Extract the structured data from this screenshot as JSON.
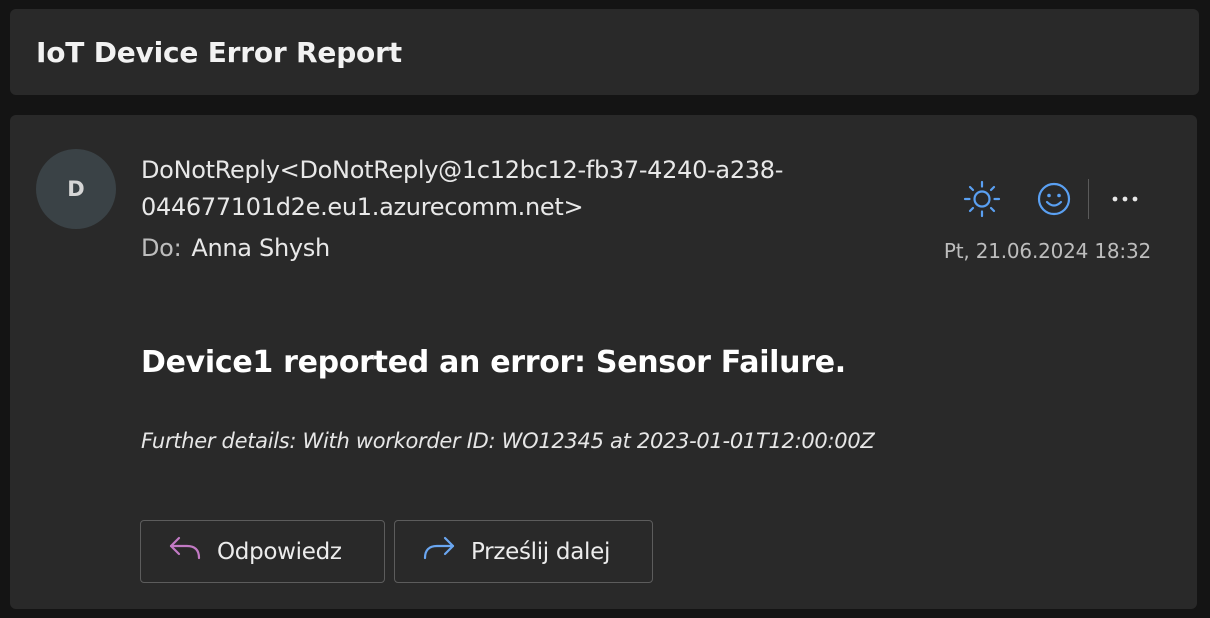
{
  "subject": "IoT Device Error Report",
  "message": {
    "avatar_initial": "D",
    "sender": "DoNotReply<DoNotReply@1c12bc12-fb37-4240-a238-044677101d2e.eu1.azurecomm.net>",
    "to_label": "Do:",
    "to_name": "Anna Shysh",
    "date": "Pt, 21.06.2024 18:32",
    "toolbar_icons": [
      "sun-icon",
      "emoji-icon",
      "more-icon"
    ],
    "body_title": "Device1 reported an error: Sensor Failure.",
    "body_details": "Further details: With workorder ID: WO12345 at 2023-01-01T12:00:00Z"
  },
  "actions": {
    "reply_label": "Odpowiedz",
    "forward_label": "Prześlij dalej"
  },
  "colors": {
    "background": "#141414",
    "card": "#292929",
    "accent_blue": "#5aa0f2",
    "reply_icon": "#c27ac4",
    "forward_icon": "#6aa6f0"
  }
}
